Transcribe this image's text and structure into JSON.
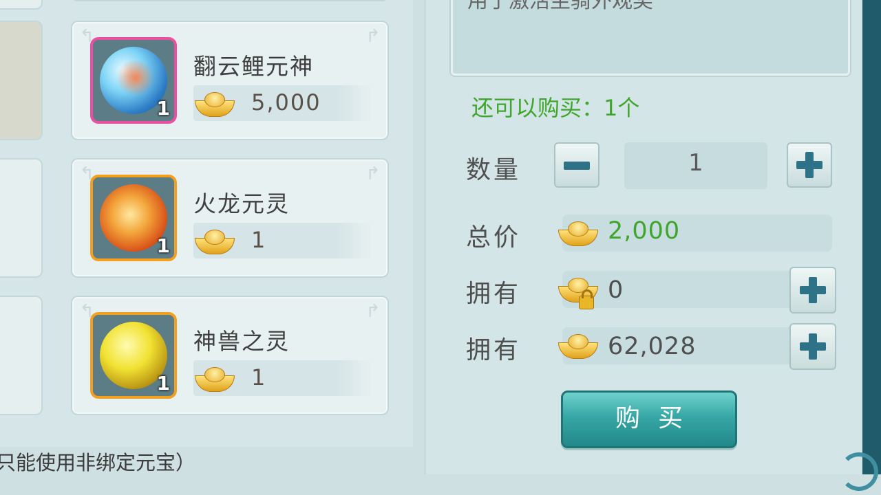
{
  "shop": {
    "items": [
      {
        "name": "翻云鲤元神",
        "price": "5,000",
        "qty": "1",
        "frame": "pink",
        "orb": "blue-fish-orb-icon"
      },
      {
        "name": "火龙元灵",
        "price": "1",
        "qty": "1",
        "frame": "orange",
        "orb": "fire-dragon-orb-icon"
      },
      {
        "name": "神兽之灵",
        "price": "1",
        "qty": "1",
        "frame": "orange",
        "orb": "golden-beast-orb-icon"
      }
    ],
    "footer_note": "只能使用非绑定元宝）"
  },
  "detail": {
    "description": "用于激活坐骑外观奖",
    "remaining": "还可以购买：1个",
    "quantity_label": "数量",
    "quantity_value": "1",
    "total_label": "总价",
    "total_value": "2,000",
    "owned_bound_label": "拥有",
    "owned_bound_value": "0",
    "owned_label": "拥有",
    "owned_value": "62,028",
    "buy_label": "购买"
  },
  "colors": {
    "accent_green": "#3fa52c",
    "button_teal": "#36a7a5",
    "rare_frame": "#ec4fa0",
    "epic_frame": "#f2a01e"
  }
}
